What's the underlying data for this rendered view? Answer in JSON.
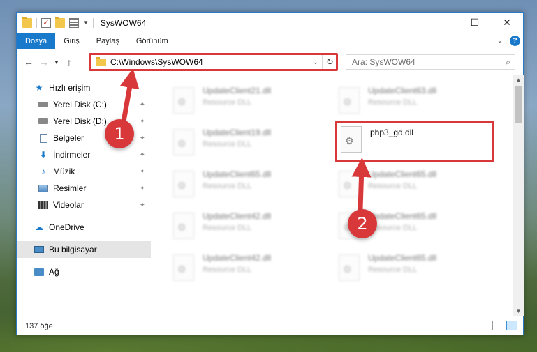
{
  "window": {
    "title": "SysWOW64",
    "minimize_glyph": "—",
    "maximize_glyph": "☐",
    "close_glyph": "✕"
  },
  "ribbon": {
    "tabs": [
      {
        "label": "Dosya"
      },
      {
        "label": "Giriş"
      },
      {
        "label": "Paylaş"
      },
      {
        "label": "Görünüm"
      }
    ],
    "help_glyph": "?"
  },
  "address": {
    "path": "C:\\Windows\\SysWOW64"
  },
  "search": {
    "placeholder": "Ara: SysWOW64"
  },
  "sidebar": {
    "items": [
      {
        "label": "Hızlı erişim",
        "icon": "star-icon"
      },
      {
        "label": "Yerel Disk (C:)",
        "icon": "drive-icon"
      },
      {
        "label": "Yerel Disk (D:)",
        "icon": "drive-icon"
      },
      {
        "label": "Belgeler",
        "icon": "documents-icon"
      },
      {
        "label": "İndirmeler",
        "icon": "downloads-icon"
      },
      {
        "label": "Müzik",
        "icon": "music-icon"
      },
      {
        "label": "Resimler",
        "icon": "pictures-icon"
      },
      {
        "label": "Videolar",
        "icon": "videos-icon"
      },
      {
        "label": "OneDrive",
        "icon": "cloud-icon"
      },
      {
        "label": "Bu bilgisayar",
        "icon": "computer-icon"
      },
      {
        "label": "Ağ",
        "icon": "network-icon"
      }
    ]
  },
  "files": {
    "highlighted": {
      "name": "php3_gd.dll"
    },
    "blurred": [
      {
        "name": "UpdateClient21.dll",
        "type": "Resource DLL"
      },
      {
        "name": "UpdateClient63.dll",
        "type": "Resource DLL"
      },
      {
        "name": "UpdateClient19.dll",
        "type": "Resource DLL"
      },
      {
        "name": "UpdateClient65.dll",
        "type": "Resource DLL"
      },
      {
        "name": "UpdateClient65.dll",
        "type": "Resource DLL"
      },
      {
        "name": "UpdateClient42.dll",
        "type": "Resource DLL"
      },
      {
        "name": "UpdateClient65.dll",
        "type": "Resource DLL"
      },
      {
        "name": "UpdateClient42.dll",
        "type": "Resource DLL"
      },
      {
        "name": "UpdateClient65.dll",
        "type": "Resource DLL"
      }
    ]
  },
  "status": {
    "item_count": "137 öğe"
  },
  "annotations": {
    "badge1": "1",
    "badge2": "2",
    "color": "#d9383b"
  }
}
